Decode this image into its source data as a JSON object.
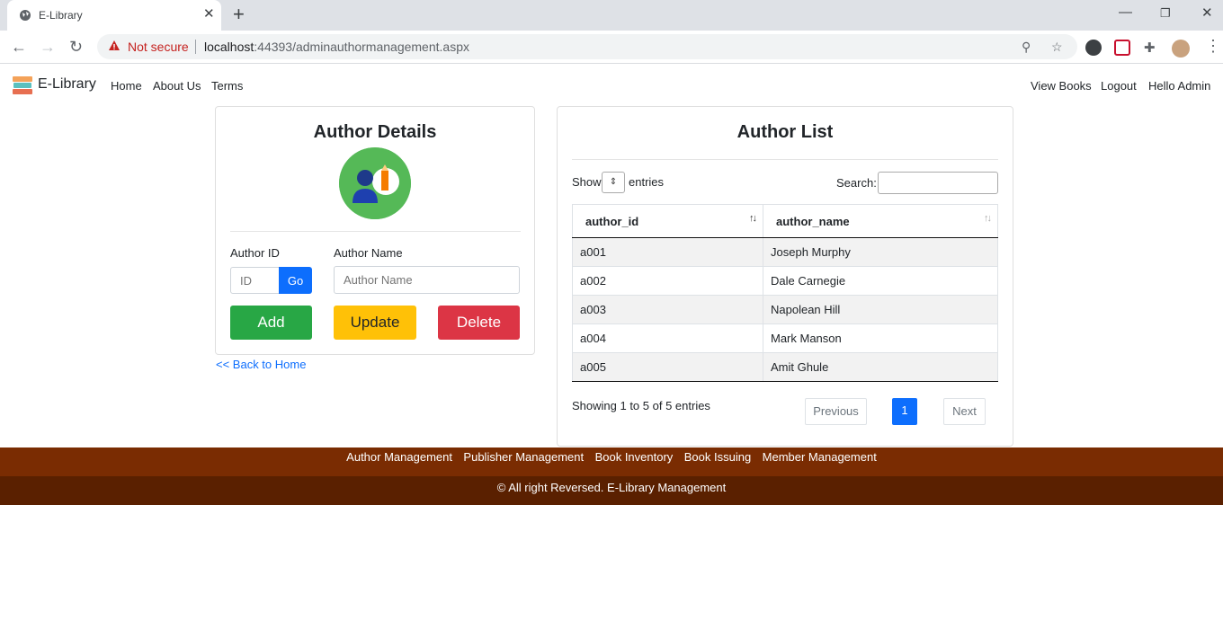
{
  "browser": {
    "tab_title": "E-Library",
    "not_secure": "Not secure",
    "url_host": "localhost",
    "url_rest": ":44393/adminauthormanagement.aspx"
  },
  "nav": {
    "brand": "E-Library",
    "links": [
      "Home",
      "About Us",
      "Terms"
    ],
    "right_links": [
      "View Books",
      "Logout",
      "Hello Admin"
    ]
  },
  "author_details": {
    "title": "Author Details",
    "author_id_label": "Author ID",
    "author_id_placeholder": "ID",
    "go_label": "Go",
    "author_name_label": "Author Name",
    "author_name_placeholder": "Author Name",
    "add_label": "Add",
    "update_label": "Update",
    "delete_label": "Delete",
    "back_link": "<< Back to Home"
  },
  "author_list": {
    "title": "Author List",
    "show_label": "Show",
    "entries_label": "entries",
    "search_label": "Search:",
    "columns": [
      "author_id",
      "author_name"
    ],
    "rows": [
      [
        "a001",
        "Joseph Murphy"
      ],
      [
        "a002",
        "Dale Carnegie"
      ],
      [
        "a003",
        "Napolean Hill"
      ],
      [
        "a004",
        "Mark Manson"
      ],
      [
        "a005",
        "Amit Ghule"
      ]
    ],
    "info": "Showing 1 to 5 of 5 entries",
    "prev_label": "Previous",
    "page": "1",
    "next_label": "Next"
  },
  "footer": {
    "links": [
      "Author Management",
      "Publisher Management",
      "Book Inventory",
      "Book Issuing",
      "Member Management"
    ],
    "copyright": "© All right Reversed. E-Library Management"
  },
  "colors": {
    "add": "#28a745",
    "update": "#ffc107",
    "delete": "#dc3545",
    "go": "#0d6efd",
    "footer_top": "#7a2c02",
    "footer_bottom": "#5a2000"
  }
}
